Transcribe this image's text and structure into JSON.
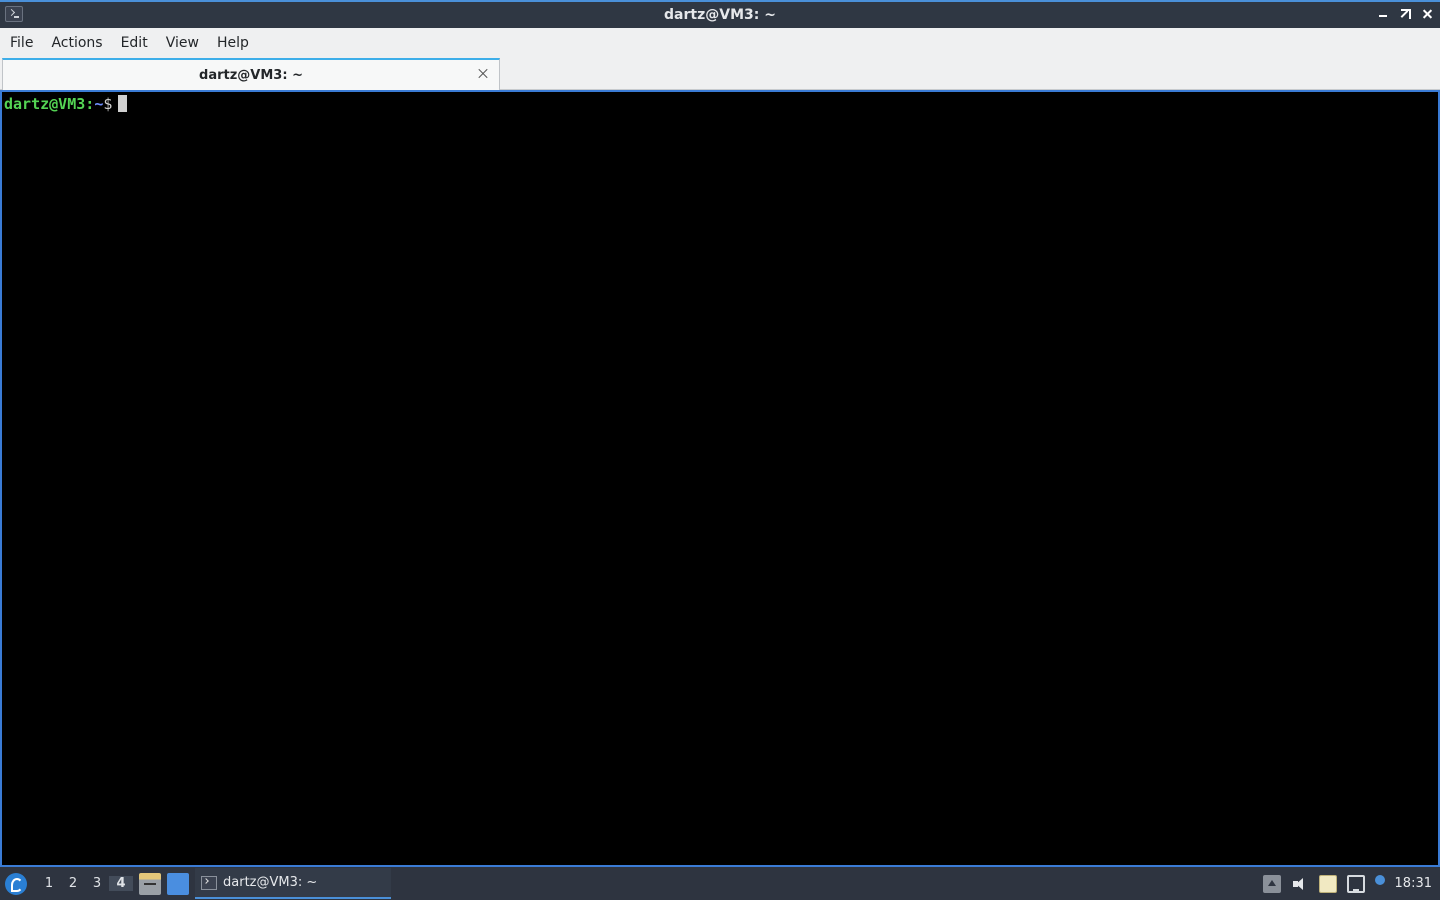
{
  "window": {
    "title": "dartz@VM3: ~",
    "icon": "terminal-icon",
    "controls": [
      "minimize-icon",
      "maximize-icon",
      "close-icon"
    ]
  },
  "menu": {
    "items": [
      {
        "label": "File"
      },
      {
        "label": "Actions"
      },
      {
        "label": "Edit"
      },
      {
        "label": "View"
      },
      {
        "label": "Help"
      }
    ]
  },
  "tabs": [
    {
      "label": "dartz@VM3: ~",
      "active": true
    }
  ],
  "terminal": {
    "user_host": "dartz@VM3",
    "separator": ":",
    "path": "~",
    "symbol": "$",
    "colors": {
      "user": "#54d454",
      "path": "#6f8fff",
      "background": "#000000"
    }
  },
  "taskbar": {
    "desktops": [
      {
        "label": "1"
      },
      {
        "label": "2"
      },
      {
        "label": "3"
      },
      {
        "label": "4",
        "active": true
      }
    ],
    "task": {
      "label": "dartz@VM3: ~"
    },
    "clock": "18:31",
    "tray_icons": [
      "show-hidden-icon",
      "volume-icon",
      "clipboard-icon",
      "network-icon",
      "notification-icon"
    ]
  }
}
